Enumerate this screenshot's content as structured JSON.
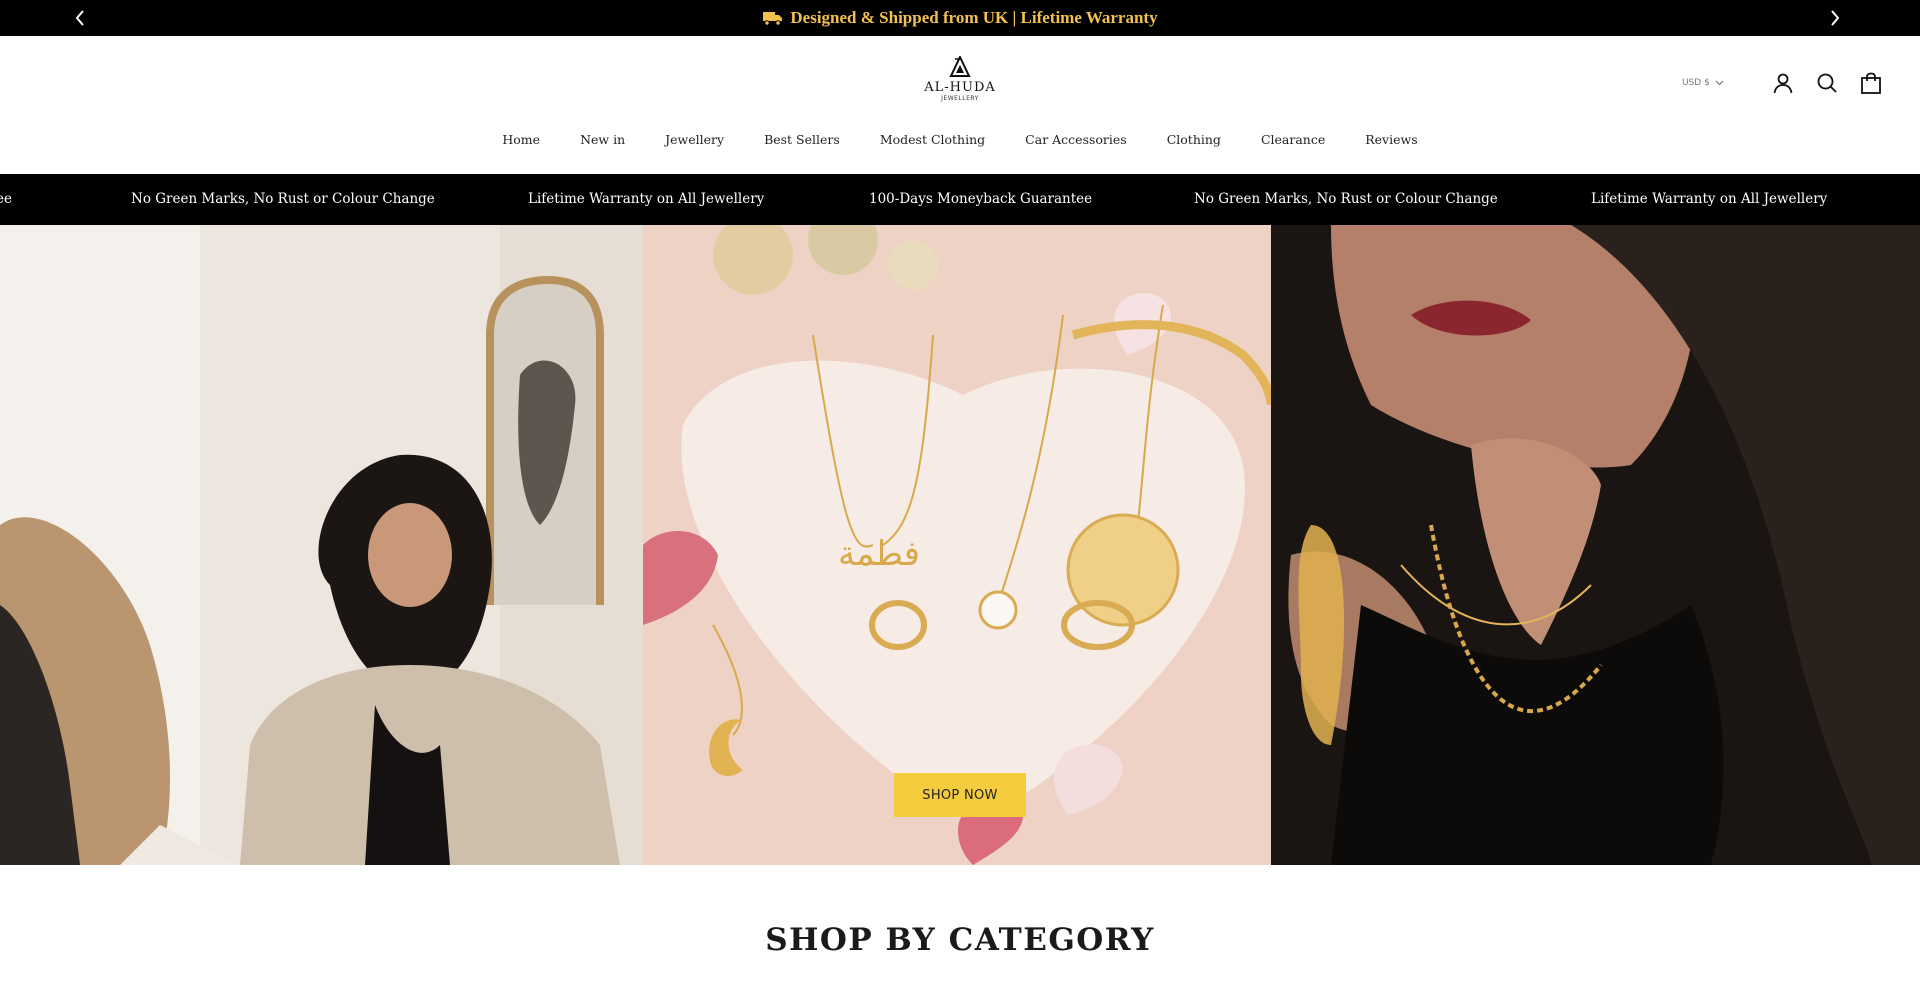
{
  "announcement": {
    "text": "Designed & Shipped from UK | Lifetime Warranty",
    "icon": "delivery-truck-icon",
    "text_color": "#f2c14e"
  },
  "brand": {
    "name": "AL-HUDA",
    "tagline": "JEWELLERY"
  },
  "header": {
    "currency": "USD $"
  },
  "nav": {
    "items": [
      "Home",
      "New in",
      "Jewellery",
      "Best Sellers",
      "Modest Clothing",
      "Car Accessories",
      "Clothing",
      "Clearance",
      "Reviews"
    ]
  },
  "ticker": {
    "items": [
      "ee",
      "No Green Marks, No Rust or Colour Change",
      "Lifetime Warranty on All Jewellery",
      "100-Days Moneyback Guarantee",
      "No Green Marks, No Rust or Colour Change",
      "Lifetime Warranty on All Jewellery"
    ]
  },
  "hero": {
    "cta_label": "SHOP NOW",
    "cta_color": "#f4cc3d"
  },
  "sections": {
    "category_title": "SHOP BY CATEGORY"
  }
}
